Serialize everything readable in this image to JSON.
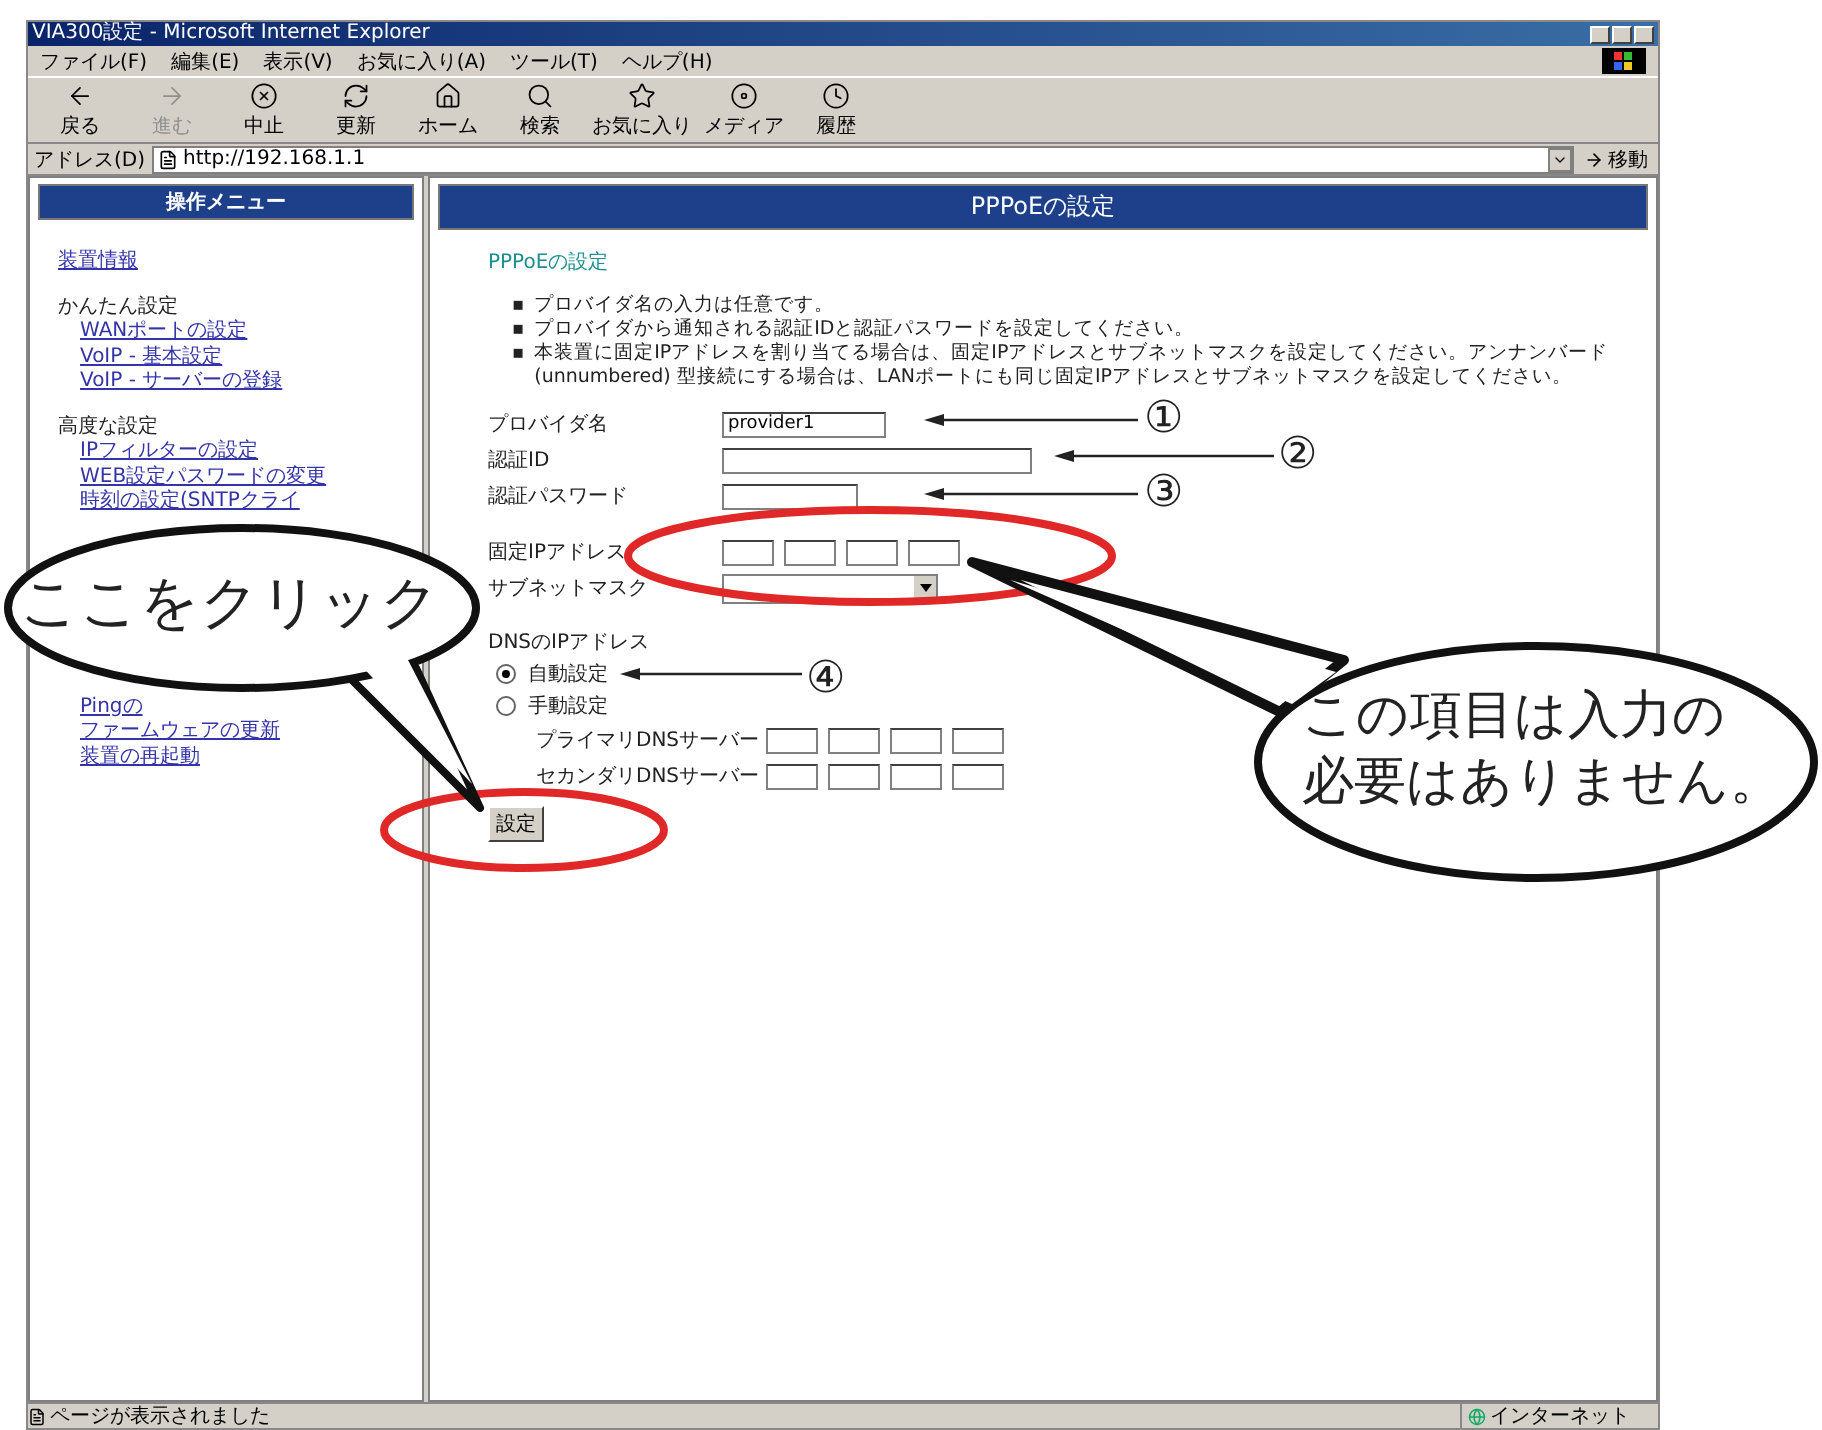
{
  "window": {
    "title": "VIA300設定 - Microsoft Internet Explorer"
  },
  "menu": [
    "ファイル(F)",
    "編集(E)",
    "表示(V)",
    "お気に入り(A)",
    "ツール(T)",
    "ヘルプ(H)"
  ],
  "toolbar": [
    {
      "kind": "back",
      "label": "戻る",
      "disabled": false
    },
    {
      "kind": "forward",
      "label": "進む",
      "disabled": true
    },
    {
      "kind": "stop",
      "label": "中止",
      "disabled": false
    },
    {
      "kind": "refresh",
      "label": "更新",
      "disabled": false
    },
    {
      "kind": "home",
      "label": "ホーム",
      "disabled": false
    },
    {
      "kind": "search",
      "label": "検索",
      "disabled": false
    },
    {
      "kind": "favorites",
      "label": "お気に入り",
      "disabled": false
    },
    {
      "kind": "media",
      "label": "メディア",
      "disabled": false
    },
    {
      "kind": "history",
      "label": "履歴",
      "disabled": false
    }
  ],
  "address": {
    "label": "アドレス(D)",
    "value": "http://192.168.1.1",
    "go": "移動"
  },
  "sidebar": {
    "title": "操作メニュー",
    "groups": [
      {
        "kind": "top",
        "items": [
          "装置情報"
        ]
      },
      {
        "kind": "section",
        "heading": "かんたん設定",
        "items": [
          "WANポートの設定",
          "VoIP - 基本設定",
          "VoIP - サーバーの登録"
        ]
      },
      {
        "kind": "section",
        "heading": "高度な設定",
        "items": [
          "IPフィルターの設定",
          "WEB設定パスワードの変更",
          "時刻の設定(SNTPクライ"
        ]
      },
      {
        "kind": "continued",
        "items": [
          "Pingの",
          "ファームウェアの更新",
          "装置の再起動"
        ]
      }
    ]
  },
  "main": {
    "banner": "PPPoEの設定",
    "heading": "PPPoEの設定",
    "bullet": "▪",
    "notes": [
      "プロバイダ名の入力は任意です。",
      "プロバイダから通知される認証IDと認証パスワードを設定してください。",
      "本装置に固定IPアドレスを割り当てる場合は、固定IPアドレスとサブネットマスクを設定してください。アンナンバード(unnumbered) 型接続にする場合は、LANポートにも同じ固定IPアドレスとサブネットマスクを設定してください。"
    ],
    "fields": [
      {
        "kind": "text",
        "label": "プロバイダ名",
        "value": "provider1"
      },
      {
        "kind": "longtext",
        "label": "認証ID"
      },
      {
        "kind": "text",
        "label": "認証パスワード"
      },
      {
        "kind": "ip",
        "label": "固定IPアドレス"
      },
      {
        "kind": "select",
        "label": "サブネットマスク"
      },
      {
        "kind": "section",
        "label": "DNSのIPアドレス"
      },
      {
        "kind": "radio",
        "label": "自動設定",
        "selected": true
      },
      {
        "kind": "radio",
        "label": "手動設定",
        "selected": false
      },
      {
        "kind": "dns",
        "label": "プライマリDNSサーバー"
      },
      {
        "kind": "dns",
        "label": "セカンダリDNSサーバー"
      }
    ],
    "submit": "設定"
  },
  "status": {
    "text": "ページが表示されました",
    "zone": "インターネット"
  },
  "annotations": {
    "callouts": [
      {
        "lines": [
          "ここをクリック"
        ]
      },
      {
        "lines": [
          "この項目は入力の",
          "必要はありません。"
        ]
      }
    ],
    "markers": [
      "①",
      "②",
      "③",
      "④"
    ]
  }
}
